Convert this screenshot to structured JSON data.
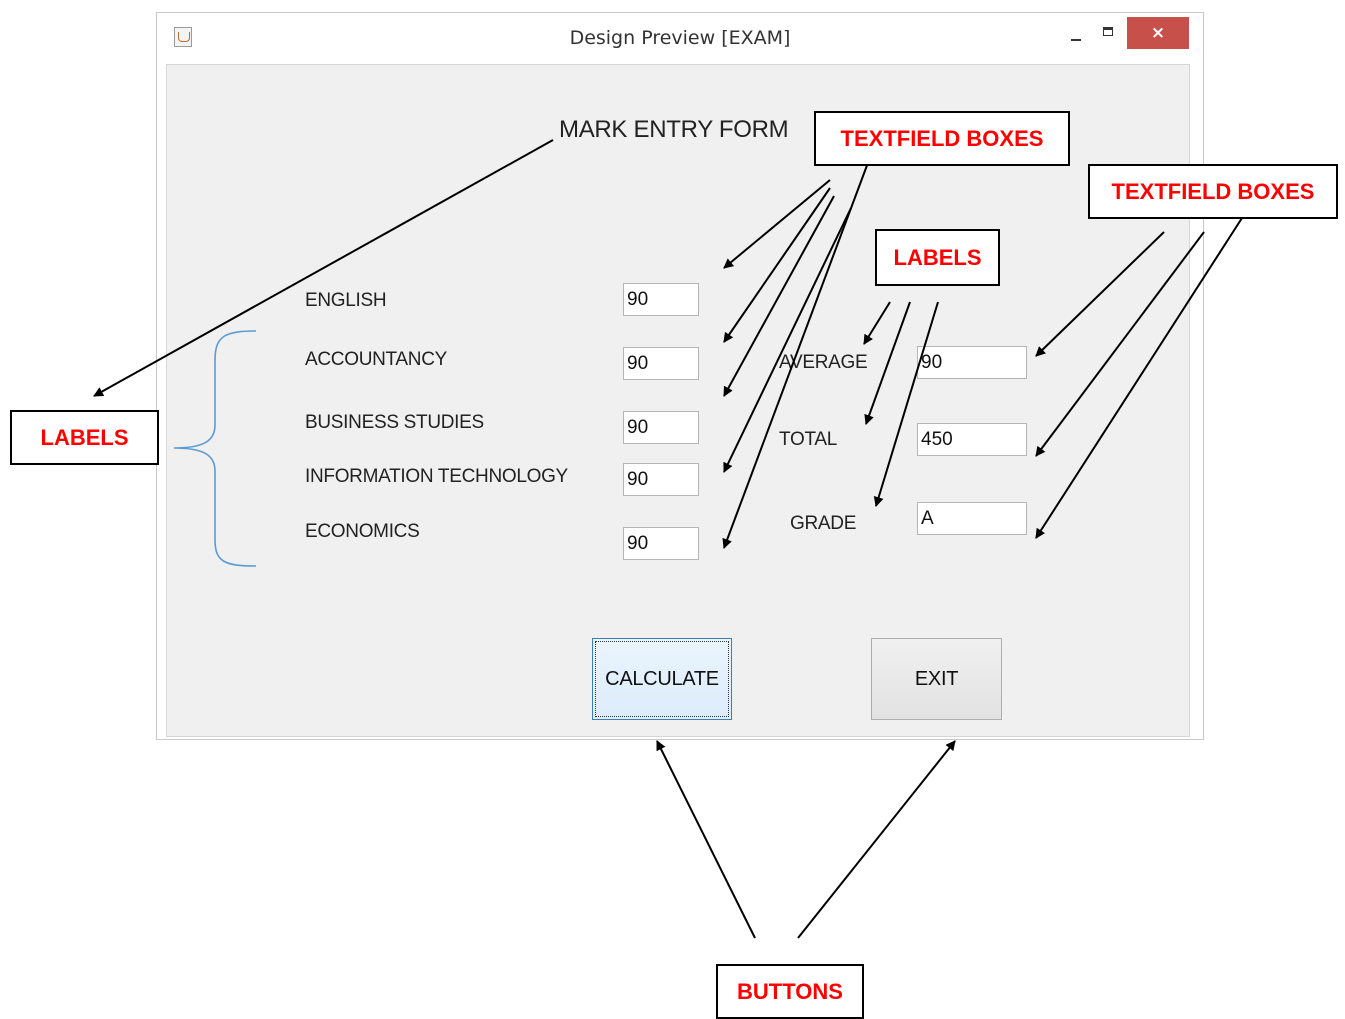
{
  "window": {
    "title": "Design Preview [EXAM]",
    "close_label": "×"
  },
  "form": {
    "heading": "MARK ENTRY FORM",
    "subjects": [
      {
        "label": "ENGLISH",
        "value": "90"
      },
      {
        "label": "ACCOUNTANCY",
        "value": "90"
      },
      {
        "label": "BUSINESS STUDIES",
        "value": "90"
      },
      {
        "label": "INFORMATION TECHNOLOGY",
        "value": "90"
      },
      {
        "label": "ECONOMICS",
        "value": "90"
      }
    ],
    "results": [
      {
        "label": "AVERAGE",
        "value": "90"
      },
      {
        "label": "TOTAL",
        "value": "450"
      },
      {
        "label": "GRADE",
        "value": "A"
      }
    ],
    "buttons": {
      "calculate": "CALCULATE",
      "exit": "EXIT"
    }
  },
  "annotations": {
    "labels_left": "LABELS",
    "textfields_top": "TEXTFIELD BOXES",
    "textfields_right": "TEXTFIELD BOXES",
    "labels_right": "LABELS",
    "buttons": "BUTTONS"
  },
  "colors": {
    "annotation_text": "#ff0000",
    "close_button": "#c7504a",
    "brace": "#5b9bd5",
    "panel_bg": "#f0f0f0"
  }
}
